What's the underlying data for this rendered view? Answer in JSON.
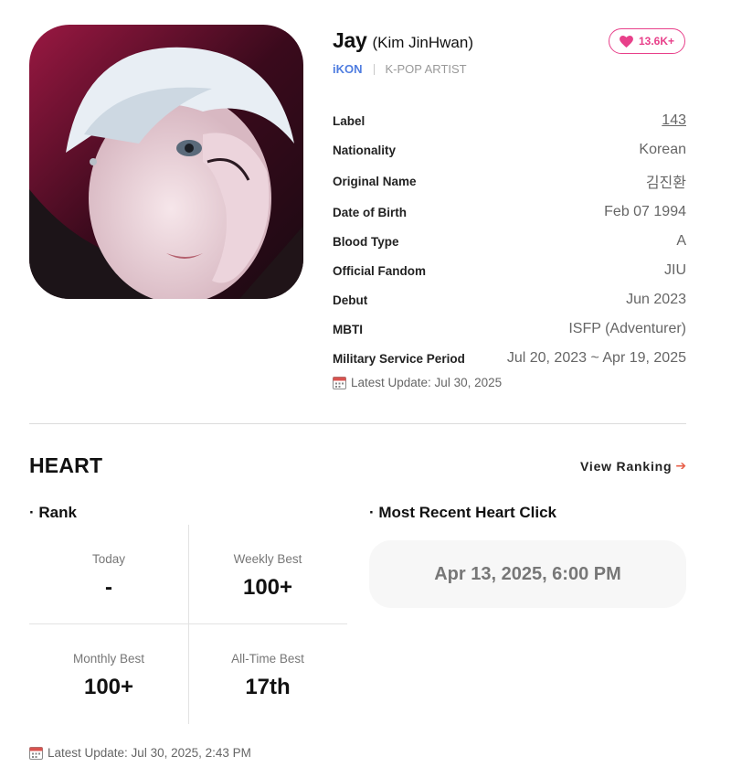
{
  "artist": {
    "name": "Jay",
    "full_name": "(Kim JinHwan)",
    "group": "iKON",
    "role": "K-POP ARTIST",
    "hearts": "13.6K+"
  },
  "info": [
    {
      "label": "Label",
      "value": "143"
    },
    {
      "label": "Nationality",
      "value": "Korean"
    },
    {
      "label": "Original Name",
      "value": "김진환"
    },
    {
      "label": "Date of Birth",
      "value": "Feb 07 1994"
    },
    {
      "label": "Blood Type",
      "value": "A"
    },
    {
      "label": "Official Fandom",
      "value": "JIU"
    },
    {
      "label": "Debut",
      "value": "Jun 2023"
    },
    {
      "label": "MBTI",
      "value": "ISFP (Adventurer)"
    },
    {
      "label": "Military Service Period",
      "value": "Jul 20, 2023 ~ Apr 19, 2025"
    }
  ],
  "info_update": "Latest Update: Jul 30, 2025",
  "heart_section": {
    "title": "HEART",
    "view_ranking": "View Ranking",
    "rank_title": "· Rank",
    "recent_title": "· Most Recent Heart Click",
    "ranks": [
      {
        "label": "Today",
        "value": "-"
      },
      {
        "label": "Weekly Best",
        "value": "100+"
      },
      {
        "label": "Monthly Best",
        "value": "100+"
      },
      {
        "label": "All-Time Best",
        "value": "17th"
      }
    ],
    "recent_click": "Apr 13, 2025, 6:00 PM",
    "update": "Latest Update: Jul 30, 2025, 2:43 PM"
  },
  "colors": {
    "accent_pink": "#e8408a",
    "link_blue": "#4f7de0",
    "arrow": "#e8604a"
  }
}
